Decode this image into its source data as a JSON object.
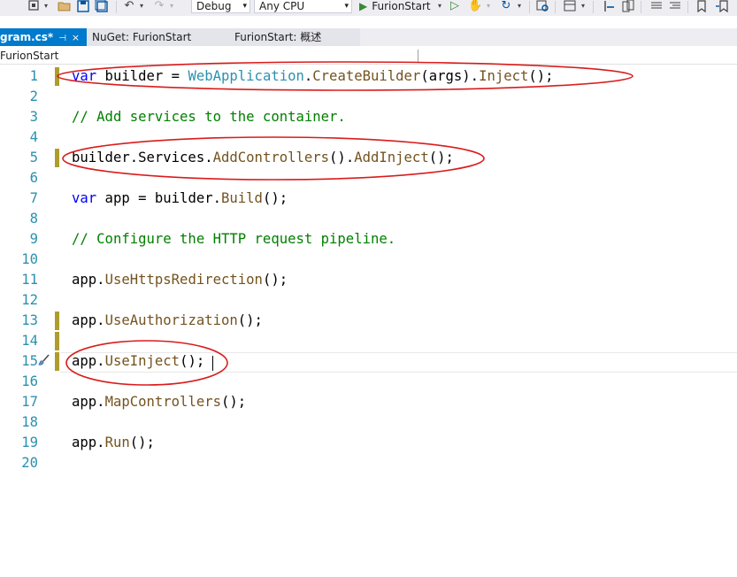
{
  "toolbar": {
    "configuration": "Debug",
    "platform": "Any CPU",
    "run_target": "FurionStart",
    "icons": [
      "solution-icon",
      "open-folder-icon",
      "save-icon",
      "save-all-icon",
      "undo-icon",
      "redo-icon",
      "start-without-debugging-icon",
      "hot-reload-icon",
      "refresh-icon",
      "find-in-files-icon",
      "layout-icon",
      "step-icon",
      "files-icon",
      "comment-icon",
      "bookmark-icon"
    ]
  },
  "tabs": [
    {
      "label": "gram.cs*",
      "active": true,
      "close": "×",
      "pin": "⊣"
    },
    {
      "label": "NuGet: FurionStart",
      "active": false
    },
    {
      "label": "FurionStart: 概述",
      "active": false
    }
  ],
  "navigation": {
    "project": "FurionStart"
  },
  "editor": {
    "lines": [
      {
        "n": "1",
        "tokens": [
          [
            "kw",
            "var"
          ],
          [
            "pl",
            " builder = "
          ],
          [
            "type",
            "WebApplication"
          ],
          [
            "pl",
            "."
          ],
          [
            "fn",
            "CreateBuilder"
          ],
          [
            "pl",
            "(args)."
          ],
          [
            "fn",
            "Inject"
          ],
          [
            "pl",
            "();"
          ]
        ],
        "changed": true,
        "circled": true
      },
      {
        "n": "2",
        "tokens": []
      },
      {
        "n": "3",
        "tokens": [
          [
            "cm",
            "// Add services to the container."
          ]
        ]
      },
      {
        "n": "4",
        "tokens": []
      },
      {
        "n": "5",
        "tokens": [
          [
            "pl",
            "builder.Services."
          ],
          [
            "fn",
            "AddControllers"
          ],
          [
            "pl",
            "()."
          ],
          [
            "fn",
            "AddInject"
          ],
          [
            "pl",
            "();"
          ]
        ],
        "changed": true,
        "circled": true
      },
      {
        "n": "6",
        "tokens": []
      },
      {
        "n": "7",
        "tokens": [
          [
            "kw",
            "var"
          ],
          [
            "pl",
            " app = builder."
          ],
          [
            "fn",
            "Build"
          ],
          [
            "pl",
            "();"
          ]
        ]
      },
      {
        "n": "8",
        "tokens": []
      },
      {
        "n": "9",
        "tokens": [
          [
            "cm",
            "// Configure the HTTP request pipeline."
          ]
        ]
      },
      {
        "n": "10",
        "tokens": []
      },
      {
        "n": "11",
        "tokens": [
          [
            "pl",
            "app."
          ],
          [
            "fn",
            "UseHttpsRedirection"
          ],
          [
            "pl",
            "();"
          ]
        ]
      },
      {
        "n": "12",
        "tokens": []
      },
      {
        "n": "13",
        "tokens": [
          [
            "pl",
            "app."
          ],
          [
            "fn",
            "UseAuthorization"
          ],
          [
            "pl",
            "();"
          ]
        ],
        "changed": true
      },
      {
        "n": "14",
        "tokens": [],
        "changed": true
      },
      {
        "n": "15",
        "tokens": [
          [
            "pl",
            "app."
          ],
          [
            "fn",
            "UseInject"
          ],
          [
            "pl",
            "();"
          ]
        ],
        "changed": true,
        "circled": true,
        "current": true
      },
      {
        "n": "16",
        "tokens": []
      },
      {
        "n": "17",
        "tokens": [
          [
            "pl",
            "app."
          ],
          [
            "fn",
            "MapControllers"
          ],
          [
            "pl",
            "();"
          ]
        ]
      },
      {
        "n": "18",
        "tokens": []
      },
      {
        "n": "19",
        "tokens": [
          [
            "pl",
            "app."
          ],
          [
            "fn",
            "Run"
          ],
          [
            "pl",
            "();"
          ]
        ]
      },
      {
        "n": "20",
        "tokens": []
      }
    ]
  },
  "colors": {
    "keyword": "#0000ff",
    "type": "#2b91af",
    "comment": "#008000",
    "method": "#74531f",
    "line_number": "#2b91af",
    "change_marker": "#ae9c2c",
    "annotation_ellipse": "#d91c1c",
    "active_tab": "#007acc"
  }
}
